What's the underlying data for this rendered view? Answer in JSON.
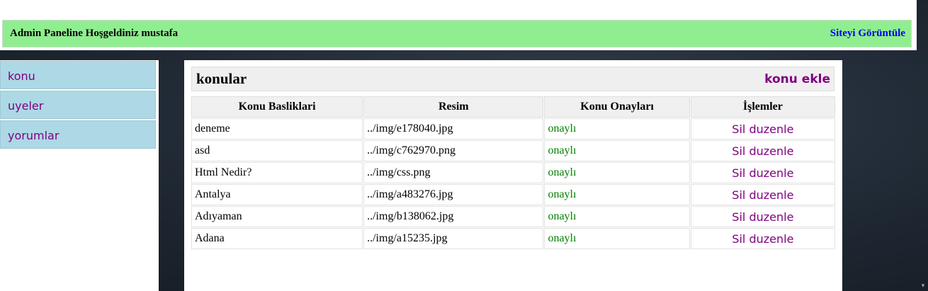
{
  "header": {
    "welcome": "Admin Paneline Hoşgeldiniz mustafa",
    "site_link": "Siteyi Görüntüle"
  },
  "sidebar": {
    "items": [
      {
        "label": "konu"
      },
      {
        "label": "uyeler"
      },
      {
        "label": "yorumlar"
      }
    ]
  },
  "content": {
    "title": "konular",
    "add_link": "konu ekle",
    "table": {
      "columns": [
        "Konu Basliklari",
        "Resim",
        "Konu Onayları",
        "İşlemler"
      ],
      "rows": [
        {
          "title": "deneme",
          "image": "../img/e178040.jpg",
          "status": "onaylı",
          "delete": "Sil",
          "edit": "duzenle"
        },
        {
          "title": "asd",
          "image": "../img/c762970.png",
          "status": "onaylı",
          "delete": "Sil",
          "edit": "duzenle"
        },
        {
          "title": "Html Nedir?",
          "image": "../img/css.png",
          "status": "onaylı",
          "delete": "Sil",
          "edit": "duzenle"
        },
        {
          "title": "Antalya",
          "image": "../img/a483276.jpg",
          "status": "onaylı",
          "delete": "Sil",
          "edit": "duzenle"
        },
        {
          "title": "Adıyaman",
          "image": "../img/b138062.jpg",
          "status": "onaylı",
          "delete": "Sil",
          "edit": "duzenle"
        },
        {
          "title": "Adana",
          "image": "../img/a15235.jpg",
          "status": "onaylı",
          "delete": "Sil",
          "edit": "duzenle"
        }
      ]
    }
  },
  "colors": {
    "header_bg": "#90ee90",
    "sidebar_item_bg": "#add8e6",
    "link_purple": "#800080",
    "status_green": "#008000",
    "site_link_blue": "#0000ee"
  },
  "icons": {
    "scroll_arrow": "chevron-down-icon"
  }
}
